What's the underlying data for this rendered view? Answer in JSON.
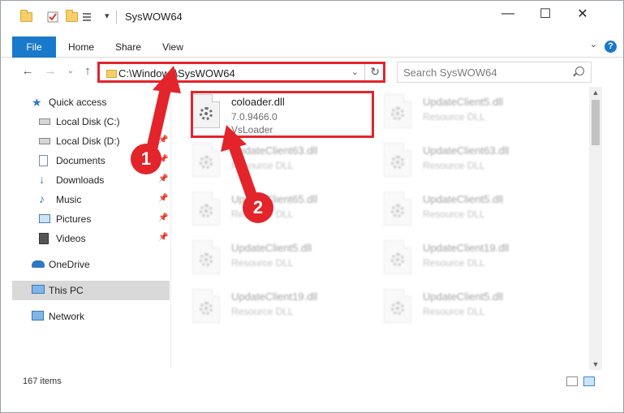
{
  "window": {
    "title": "SysWOW64",
    "controls": {
      "minimize": "—",
      "maximize": "☐",
      "close": "✕"
    }
  },
  "ribbon": {
    "tabs": [
      "File",
      "Home",
      "Share",
      "View"
    ],
    "help": "?",
    "expand": "⌄"
  },
  "nav": {
    "back": "←",
    "forward": "→",
    "recent": "⌄",
    "up": "↑",
    "address": "C:\\Windows\\SysWOW64",
    "search_placeholder": "Search SysWOW64"
  },
  "sidebar": {
    "items": [
      {
        "label": "Quick access",
        "icon": "star-icon"
      },
      {
        "label": "Local Disk (C:)",
        "icon": "drive-icon"
      },
      {
        "label": "Local Disk (D:)",
        "icon": "drive-icon"
      },
      {
        "label": "Documents",
        "icon": "documents-icon"
      },
      {
        "label": "Downloads",
        "icon": "download-icon"
      },
      {
        "label": "Music",
        "icon": "music-icon"
      },
      {
        "label": "Pictures",
        "icon": "pictures-icon"
      },
      {
        "label": "Videos",
        "icon": "videos-icon"
      },
      {
        "label": "OneDrive",
        "icon": "cloud-icon"
      },
      {
        "label": "This PC",
        "icon": "pc-icon"
      },
      {
        "label": "Network",
        "icon": "network-icon"
      }
    ]
  },
  "files": {
    "highlighted": {
      "name": "coloader.dll",
      "version": "7.0.9466.0",
      "company": "VsLoader"
    },
    "others": [
      {
        "name": "UpdateClient5.dll",
        "type": "Resource DLL"
      },
      {
        "name": "UpdateClient63.dll",
        "type": "Resource DLL"
      },
      {
        "name": "UpdateClient63.dll",
        "type": "Resource DLL"
      },
      {
        "name": "UpdateClient65.dll",
        "type": "Resource DLL"
      },
      {
        "name": "UpdateClient5.dll",
        "type": "Resource DLL"
      },
      {
        "name": "UpdateClient5.dll",
        "type": "Resource DLL"
      },
      {
        "name": "UpdateClient19.dll",
        "type": "Resource DLL"
      },
      {
        "name": "UpdateClient19.dll",
        "type": "Resource DLL"
      },
      {
        "name": "UpdateClient5.dll",
        "type": "Resource DLL"
      }
    ]
  },
  "status": {
    "item_count": "167 items"
  },
  "callouts": {
    "step1": "1",
    "step2": "2",
    "color": "#e3242b"
  }
}
